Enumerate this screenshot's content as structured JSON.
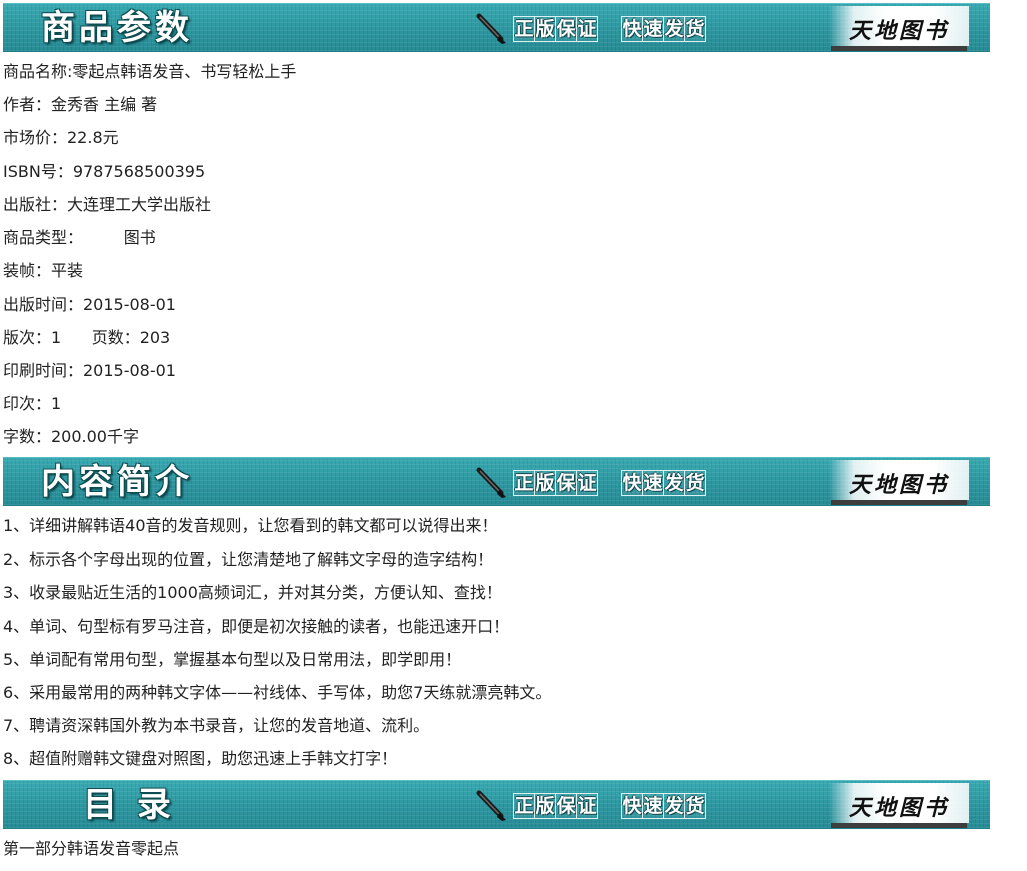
{
  "banners": {
    "params": {
      "title": "商品参数"
    },
    "intro": {
      "title": "内容简介"
    },
    "toc": {
      "title": "目 录"
    },
    "tag_left": [
      "正",
      "版",
      "保",
      "证"
    ],
    "tag_right": [
      "快",
      "速",
      "发",
      "货"
    ],
    "brand": "天地图书"
  },
  "params": {
    "name": "商品名称:零起点韩语发音、书写轻松上手",
    "author": "作者：金秀香 主编 著",
    "price": "市场价：22.8元",
    "isbn": "ISBN号：9787568500395",
    "publisher": "出版社：大连理工大学出版社",
    "type": "商品类型：        图书",
    "binding": "装帧：平装",
    "pub_date": "出版时间：2015-08-01",
    "edition_pages": "版次：1      页数：203",
    "print_date": "印刷时间：2015-08-01",
    "print_count": "印次：1",
    "word_count": "字数：200.00千字"
  },
  "intro": {
    "items": [
      "1、详细讲解韩语40音的发音规则，让您看到的韩文都可以说得出来！",
      "2、标示各个字母出现的位置，让您清楚地了解韩文字母的造字结构！",
      "3、收录最贴近生活的1000高频词汇，并对其分类，方便认知、查找！",
      "4、单词、句型标有罗马注音，即便是初次接触的读者，也能迅速开口！",
      "5、单词配有常用句型，掌握基本句型以及日常用法，即学即用！",
      "6、采用最常用的两种韩文字体——衬线体、手写体，助您7天练就漂亮韩文。",
      "7、聘请资深韩国外教为本书录音，让您的发音地道、流利。",
      "8、超值附赠韩文键盘对照图，助您迅速上手韩文打字！"
    ]
  },
  "toc": {
    "first": "第一部分韩语发音零起点"
  },
  "colors": {
    "banner_teal": "#2e9aa3",
    "text": "#222222"
  },
  "icons": [
    "brush-icon"
  ]
}
